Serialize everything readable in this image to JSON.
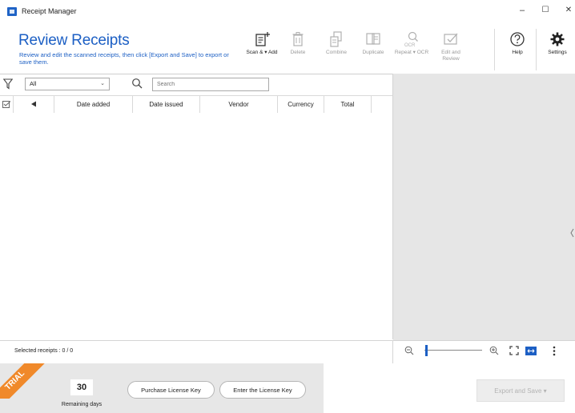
{
  "window": {
    "title": "Receipt Manager",
    "minimize": "–",
    "maximize": "☐",
    "close": "✕"
  },
  "header": {
    "title": "Review Receipts",
    "subtitle": "Review and edit the scanned receipts, then click [Export and Save] to export or save them."
  },
  "toolbar": {
    "scan_add": "Scan & ▾ Add",
    "delete": "Delete",
    "combine": "Combine",
    "duplicate": "Duplicate",
    "repeat_ocr": "Repeat ▾ OCR",
    "edit_review": "Edit and Review",
    "help": "Help",
    "settings": "Settings"
  },
  "filter": {
    "selected": "All",
    "search_placeholder": "Search"
  },
  "table": {
    "columns": [
      "Date added",
      "Date issued",
      "Vendor",
      "Currency",
      "Total"
    ],
    "rows": []
  },
  "status": {
    "selected_receipts": "Selected receipts : 0 / 0"
  },
  "license": {
    "badge": "TRIAL",
    "remaining_value": "30",
    "remaining_label": "Remaining days",
    "purchase_button": "Purchase License Key",
    "enter_button": "Enter the License Key"
  },
  "export_button": "Export and Save ▾",
  "colors": {
    "accent": "#1c5fc4",
    "trial": "#f0892a",
    "preview_bg": "#e6e6e6",
    "license_bg": "#e7e7e7"
  },
  "preview": {
    "zoom_level": 0.02
  }
}
